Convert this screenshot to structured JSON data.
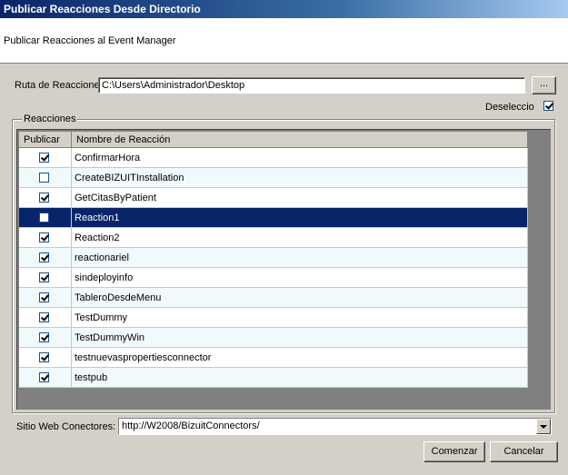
{
  "window": {
    "title": "Publicar Reacciones Desde Directorio"
  },
  "header": {
    "subtitle": "Publicar Reacciones al Event Manager"
  },
  "path": {
    "label": "Ruta de Reaccione",
    "value": "C:\\Users\\Administrador\\Desktop",
    "browse_label": "..."
  },
  "deselect": {
    "label": "Deseleccio",
    "checked": true
  },
  "group": {
    "title": "Reacciones"
  },
  "grid": {
    "columns": [
      "Publicar",
      "Nombre de Reacción"
    ],
    "rows": [
      {
        "name": "ConfirmarHora",
        "checked": true
      },
      {
        "name": "CreateBIZUITInstallation",
        "checked": false
      },
      {
        "name": "GetCitasByPatient",
        "checked": true
      },
      {
        "name": "Reaction1",
        "checked": false,
        "selected": true
      },
      {
        "name": "Reaction2",
        "checked": true
      },
      {
        "name": "reactionariel",
        "checked": true
      },
      {
        "name": "sindeployinfo",
        "checked": true
      },
      {
        "name": "TableroDesdeMenu",
        "checked": true
      },
      {
        "name": "TestDummy",
        "checked": true
      },
      {
        "name": "TestDummyWin",
        "checked": true
      },
      {
        "name": "testnuevaspropertiesconnector",
        "checked": true
      },
      {
        "name": "testpub",
        "checked": true
      }
    ]
  },
  "site": {
    "label": "Sitio Web Conectores:",
    "value": "http://W2008/BizuitConnectors/"
  },
  "buttons": {
    "start": "Comenzar",
    "cancel": "Cancelar"
  }
}
